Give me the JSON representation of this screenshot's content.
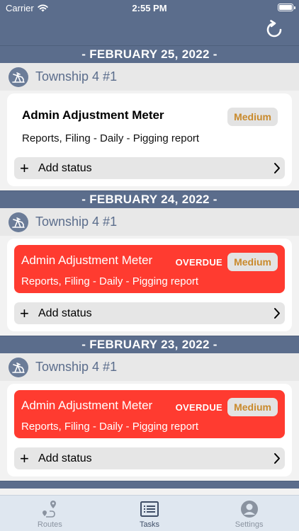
{
  "status_bar": {
    "carrier": "Carrier",
    "time": "2:55 PM"
  },
  "navbar": {
    "refresh_icon": "refresh-icon"
  },
  "sections": [
    {
      "date": "- FEBRUARY 25, 2022 -",
      "route": "Township 4 #1",
      "task": {
        "title": "Admin Adjustment Meter",
        "subtitle": "Reports, Filing - Daily - Pigging report",
        "priority": "Medium",
        "overdue_label": ""
      },
      "add_status": "Add status"
    },
    {
      "date": "- FEBRUARY 24, 2022 -",
      "route": "Township 4 #1",
      "task": {
        "title": "Admin Adjustment Meter",
        "subtitle": "Reports, Filing - Daily - Pigging report",
        "priority": "Medium",
        "overdue_label": "OVERDUE"
      },
      "add_status": "Add status"
    },
    {
      "date": "- FEBRUARY 23, 2022 -",
      "route": "Township 4 #1",
      "task": {
        "title": "Admin Adjustment Meter",
        "subtitle": "Reports, Filing - Daily - Pigging report",
        "priority": "Medium",
        "overdue_label": "OVERDUE"
      },
      "add_status": "Add status"
    }
  ],
  "tabs": [
    {
      "label": "Routes",
      "icon": "route-pin-icon",
      "active": false
    },
    {
      "label": "Tasks",
      "icon": "task-list-icon",
      "active": true
    },
    {
      "label": "Settings",
      "icon": "person-circle-icon",
      "active": false
    }
  ],
  "colors": {
    "nav": "#5b6d8c",
    "overdue": "#ff3b30",
    "priority_text": "#c98a2c",
    "tabbar": "#dfe7f0"
  }
}
